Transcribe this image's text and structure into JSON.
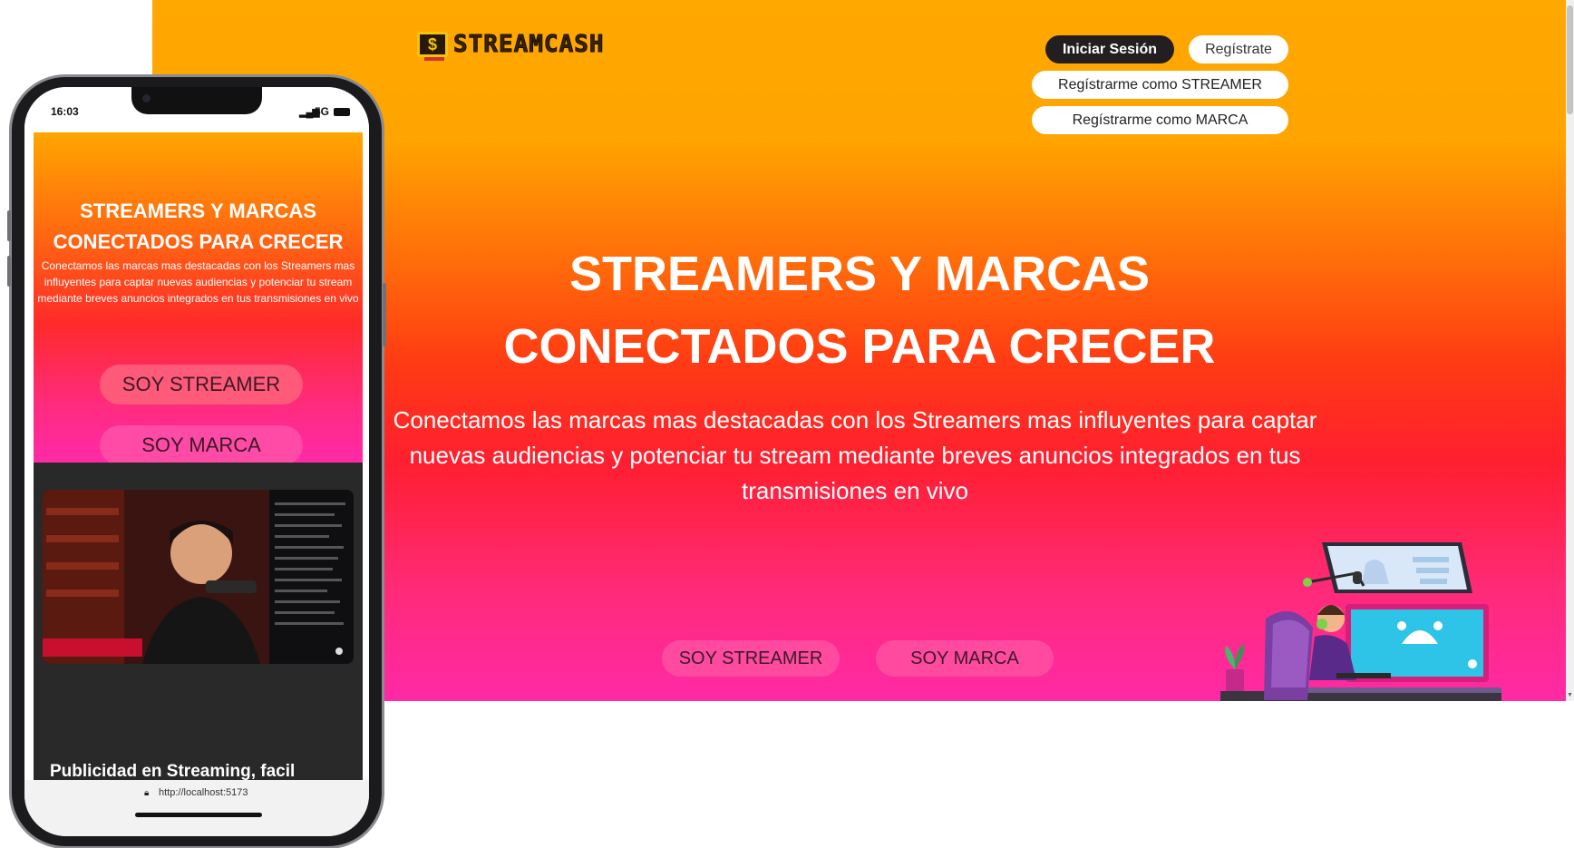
{
  "brand": {
    "logo_symbol": "$",
    "name": "STREAMCASH"
  },
  "nav": {
    "login": "Iniciar Sesión",
    "register": "Regístrate",
    "register_streamer": "Regístrarme como STREAMER",
    "register_brand": "Regístrarme como MARCA"
  },
  "hero": {
    "title_line1": "STREAMERS Y MARCAS",
    "title_line2": "CONECTADOS PARA CRECER",
    "subtitle": "Conectamos las marcas mas destacadas con los Streamers mas influyentes para captar nuevas audiencias y potenciar tu stream mediante breves anuncios integrados en tus transmisiones en vivo",
    "cta_streamer": "SOY STREAMER",
    "cta_brand": "SOY MARCA"
  },
  "mobile": {
    "status_time": "16:03",
    "status_network": "5G",
    "next_section_title": "Publicidad en Streaming, facil",
    "url": "http://localhost:5173"
  },
  "colors": {
    "gradient_top": "#ffa800",
    "gradient_mid": "#ff1f30",
    "gradient_bottom": "#ff2aa6",
    "cta_pink": "#ff4aa0",
    "dark_button": "#231f20",
    "dark_section": "#292929"
  },
  "icons": {
    "lock": "lock-icon",
    "signal": "signal-icon",
    "battery": "battery-icon"
  }
}
